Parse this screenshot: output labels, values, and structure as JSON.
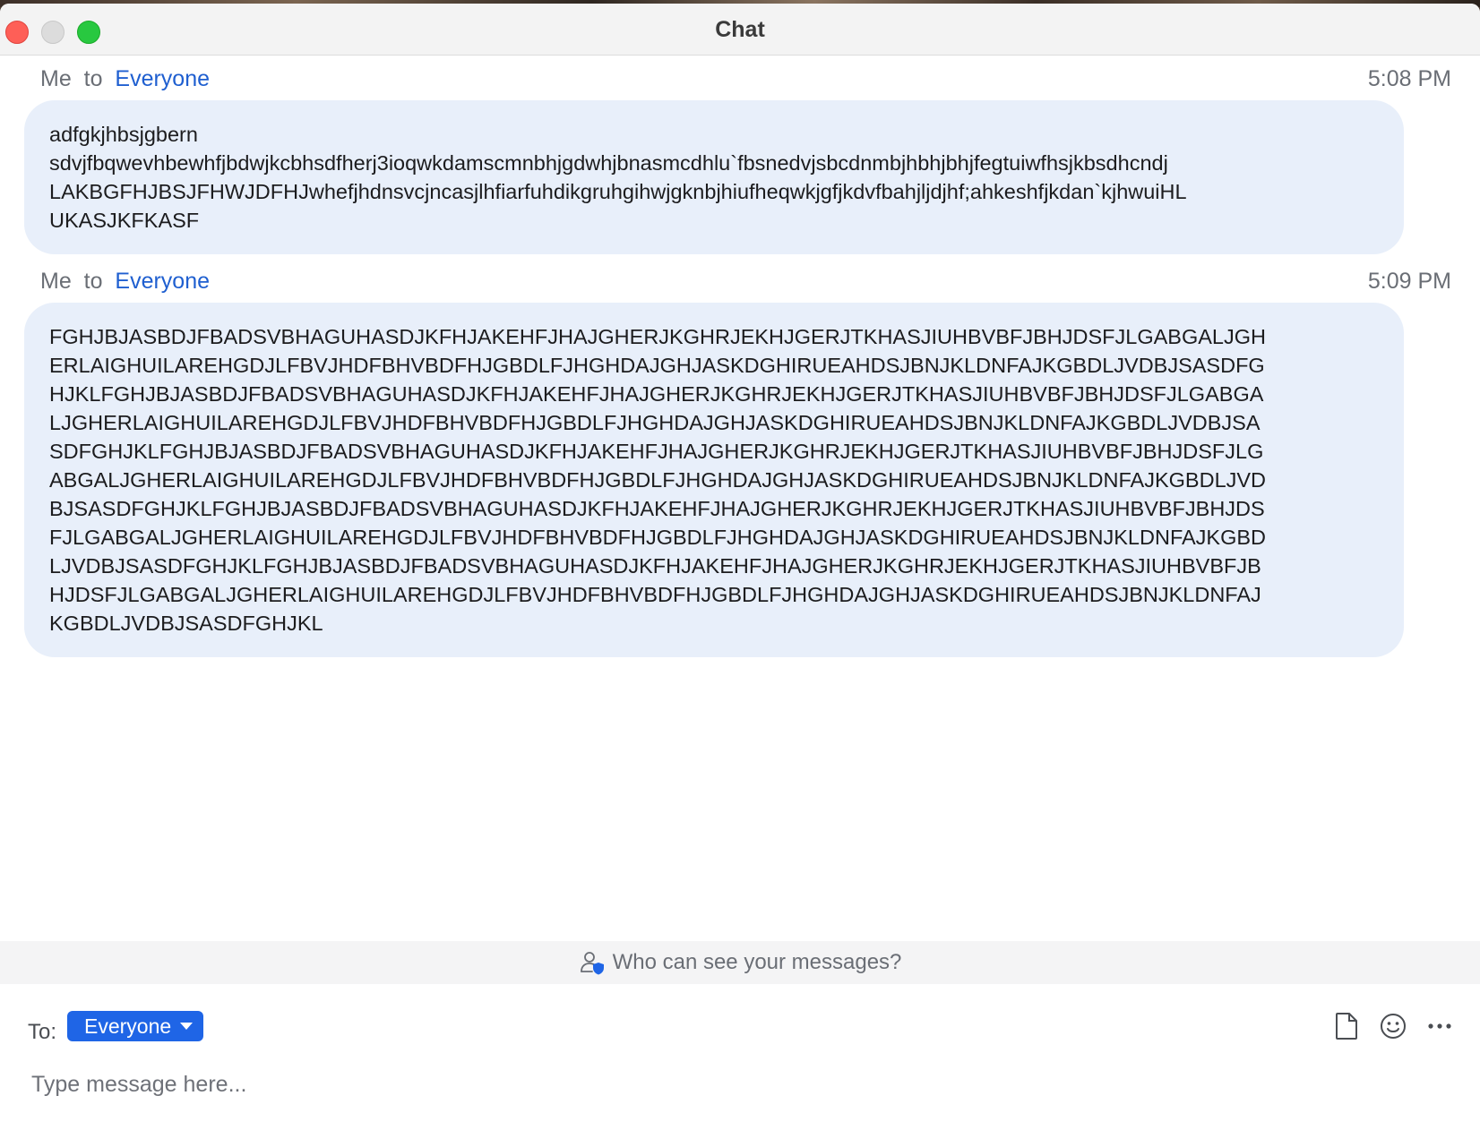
{
  "window": {
    "title": "Chat"
  },
  "messages": [
    {
      "sender": "Me",
      "to_word": "to",
      "recipient": "Everyone",
      "time": "5:08 PM",
      "lines": [
        "adfgkjhbsjgbern",
        "sdvjfbqwevhbewhfjbdwjkcbhsdfherj3ioqwkdamscmnbhjgdwhjbnasmcdhlu`fbsnedvjsbcdnmbjhbhjbhjfegtuiwfhsjkbsdhcndj",
        "LAKBGFHJBSJFHWJDFHJwhefjhdnsvcjncasjlhfiarfuhdikgruhgihwjgknbjhiufheqwkjgfjkdvfbahjljdjhf;ahkeshfjkdan`kjhwuiHL",
        "UKASJKFKASF"
      ]
    },
    {
      "sender": "Me",
      "to_word": "to",
      "recipient": "Everyone",
      "time": "5:09 PM",
      "lines": [
        "FGHJBJASBDJFBADSVBHAGUHASDJKFHJAKEHFJHAJGHERJKGHRJEKHJGERJTKHASJIUHBVBFJBHJDSFJLGABGALJGH",
        "ERLAIGHUILAREHGDJLFBVJHDFBHVBDFHJGBDLFJHGHDAJGHJASKDGHIRUEAHDSJBNJKLDNFAJKGBDLJVDBJSASDFG",
        "HJKLFGHJBJASBDJFBADSVBHAGUHASDJKFHJAKEHFJHAJGHERJKGHRJEKHJGERJTKHASJIUHBVBFJBHJDSFJLGABGA",
        "LJGHERLAIGHUILAREHGDJLFBVJHDFBHVBDFHJGBDLFJHGHDAJGHJASKDGHIRUEAHDSJBNJKLDNFAJKGBDLJVDBJSA",
        "SDFGHJKLFGHJBJASBDJFBADSVBHAGUHASDJKFHJAKEHFJHAJGHERJKGHRJEKHJGERJTKHASJIUHBVBFJBHJDSFJLG",
        "ABGALJGHERLAIGHUILAREHGDJLFBVJHDFBHVBDFHJGBDLFJHGHDAJGHJASKDGHIRUEAHDSJBNJKLDNFAJKGBDLJVD",
        "BJSASDFGHJKLFGHJBJASBDJFBADSVBHAGUHASDJKFHJAKEHFJHAJGHERJKGHRJEKHJGERJTKHASJIUHBVBFJBHJDS",
        "FJLGABGALJGHERLAIGHUILAREHGDJLFBVJHDFBHVBDFHJGBDLFJHGHDAJGHJASKDGHIRUEAHDSJBNJKLDNFAJKGBD",
        "LJVDBJSASDFGHJKLFGHJBJASBDJFBADSVBHAGUHASDJKFHJAKEHFJHAJGHERJKGHRJEKHJGERJTKHASJIUHBVBFJB",
        "HJDSFJLGABGALJGHERLAIGHUILAREHGDJLFBVJHDFBHVBDFHJGBDLFJHGHDAJGHJASKDGHIRUEAHDSJBNJKLDNFAJ",
        "KGBDLJVDBJSASDFGHJKL"
      ]
    }
  ],
  "privacy": {
    "text": "Who can see your messages?"
  },
  "composer": {
    "to_label": "To:",
    "recipient": "Everyone",
    "placeholder": "Type message here...",
    "icons": [
      "file-icon",
      "emoji-icon",
      "more-icon"
    ]
  },
  "colors": {
    "bubble": "#e8effa",
    "accent": "#1f65e6",
    "link": "#1f5fd0",
    "close": "#fe5f57",
    "maximize": "#28c840"
  }
}
